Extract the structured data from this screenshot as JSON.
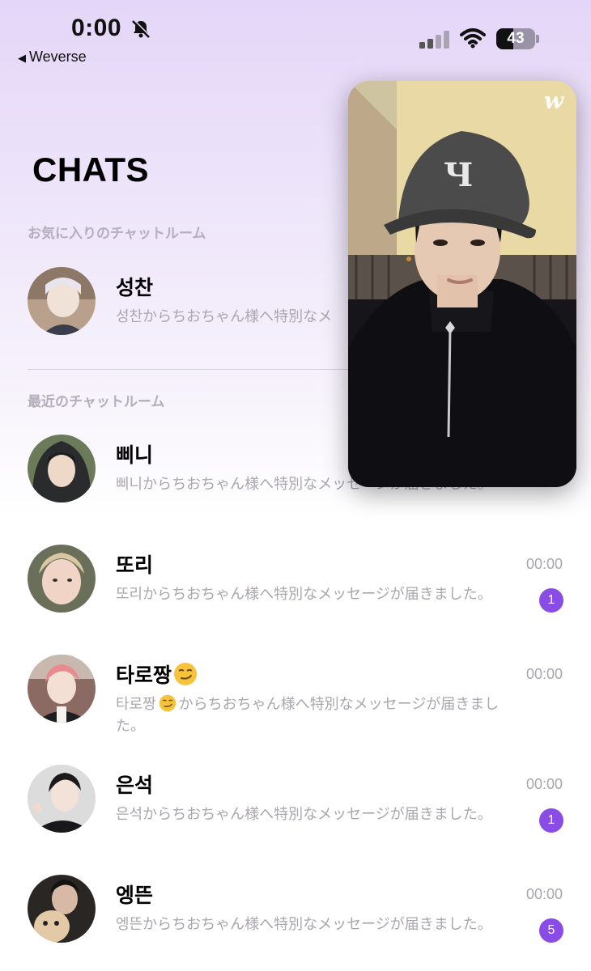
{
  "status_bar": {
    "time": "0:00",
    "back_app": "Weverse",
    "battery": "43",
    "battery_level": 0.43
  },
  "page": {
    "title": "CHATS",
    "favorites_label": "お気に入りのチャットルーム",
    "recent_label": "最近のチャットルーム"
  },
  "favorites": [
    {
      "name": "성찬",
      "message": "성찬からちおちゃん様へ特別なメッセージが届きました。",
      "avatar": "avatar-photo"
    }
  ],
  "recent": [
    {
      "name": "삐니",
      "message": "삐니からちおちゃん様へ特別なメッセージが届きました。",
      "time": "",
      "badge": ""
    },
    {
      "name": "또리",
      "message": "또리からちおちゃん様へ特別なメッセージが届きました。",
      "time": "00:00",
      "badge": "1"
    },
    {
      "name": "타로짱",
      "name_emoji": "smirk-emoji",
      "message_prefix": "타로짱",
      "message": "からちおちゃん様へ特別なメッセージが届きました。",
      "time": "00:00",
      "badge": ""
    },
    {
      "name": "은석",
      "message": "은석からちおちゃん様へ特別なメッセージが届きました。",
      "time": "00:00",
      "badge": "1"
    },
    {
      "name": "엥뜬",
      "message": "엥뜬からちおちゃん様へ特別なメッセージが届きました。",
      "time": "00:00",
      "badge": "5"
    }
  ],
  "pip": {
    "logo": "w"
  },
  "colors": {
    "accent": "#8a4ce6",
    "muted_text": "#a9a6ad",
    "section_text": "#b4aebd"
  }
}
